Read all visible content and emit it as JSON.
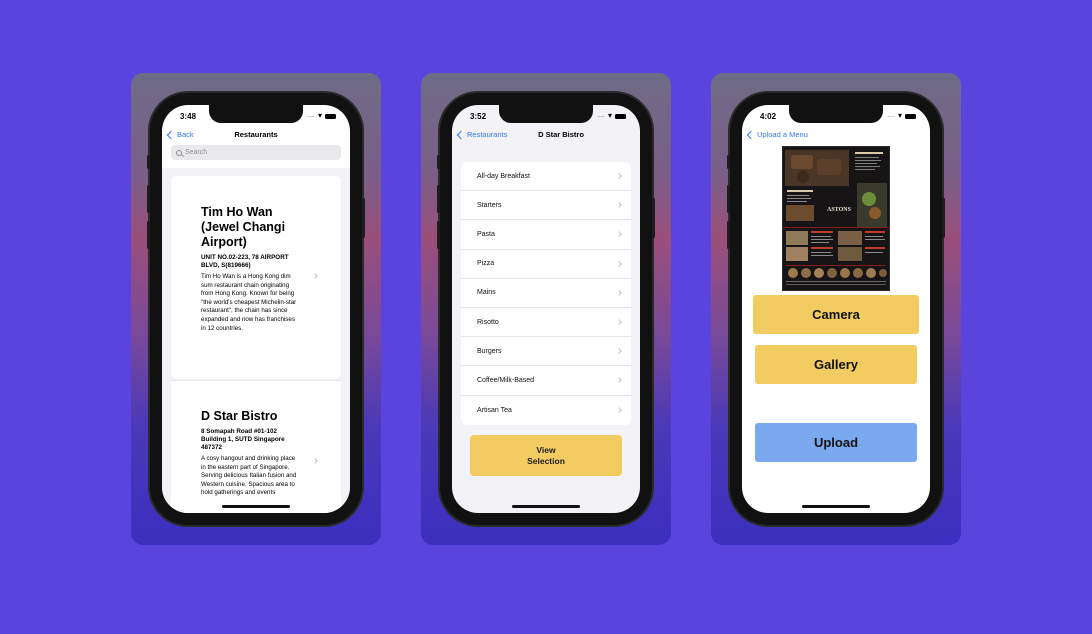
{
  "colors": {
    "background": "#5b44dd",
    "accent_yellow": "#f2cc60",
    "accent_blue": "#7ba9f0",
    "ios_link": "#3478f6"
  },
  "status": {
    "signal": "....",
    "wifi_icon": "wifi-icon",
    "battery_icon": "battery-icon"
  },
  "screen1": {
    "time": "3:48",
    "back_label": "Back",
    "title": "Restaurants",
    "search_placeholder": "Search",
    "restaurants": [
      {
        "name": "Tim Ho Wan (Jewel Changi Airport)",
        "address": "UNIT NO.02-223, 78 AIRPORT BLVD, S(819666)",
        "description": "Tim Ho Wan is a Hong Kong dim sum restaurant chain originating from Hong Kong. Known for being \"the world's cheapest Michelin-star restaurant\", the chain has since expanded and now has franchises in 12 countries."
      },
      {
        "name": "D Star Bistro",
        "address": "8 Somapah Road #01-102 Building 1, SUTD Singapore 487372",
        "description": "A cosy hangout and drinking place in the eastern part of Singapore. Serving delicious Italian fusion and Western cuisine. Spacious area to hold gatherings and events"
      }
    ]
  },
  "screen2": {
    "time": "3:52",
    "back_label": "Restaurants",
    "title": "D Star Bistro",
    "categories": [
      "All-day Breakfast",
      "Starters",
      "Pasta",
      "Pizza",
      "Mains",
      "Risotto",
      "Burgers",
      "Coffee/Milk-Based",
      "Artisan Tea"
    ],
    "view_button_line1": "View",
    "view_button_line2": "Selection"
  },
  "screen3": {
    "time": "4:02",
    "back_label": "Upload a Menu",
    "menu_brand": "ASTONS",
    "camera_label": "Camera",
    "gallery_label": "Gallery",
    "upload_label": "Upload"
  }
}
